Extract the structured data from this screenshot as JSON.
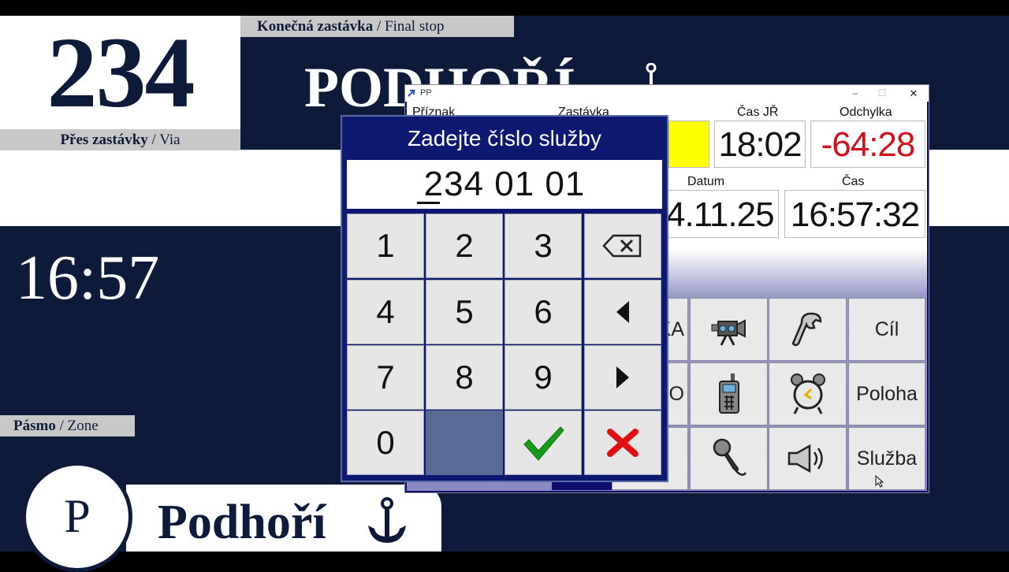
{
  "sign": {
    "route_number": "234",
    "via_label": "Přes zastávky",
    "via_label_en": "Via",
    "final_label": "Konečná zastávka",
    "final_label_en": "Final stop",
    "destination": "PODHOŘÍ",
    "clock": "16:57",
    "zone_label": "Pásmo",
    "zone_label_en": "Zone",
    "zone_letter": "P",
    "current_stop": "Podhoří"
  },
  "pp_window": {
    "title": "PP",
    "controls": {
      "minimize": "–",
      "maximize": "☐",
      "close": "✕"
    },
    "headers": {
      "flag": "Příznak",
      "stop": "Zastávka",
      "schedule_time": "Čas JŘ",
      "deviation": "Odchylka",
      "date": "Datum",
      "time": "Čas"
    },
    "values": {
      "schedule_time": "18:02",
      "deviation": "-64:28",
      "date": "4.11.25",
      "time": "16:57:32"
    },
    "buttons": {
      "partial_a": "KA",
      "partial_b": "O",
      "target": "Cíl",
      "position": "Poloha",
      "service": "Služba"
    },
    "icons": [
      "camera-icon",
      "wrench-icon",
      "phone-icon",
      "alarm-clock-icon",
      "microphone-icon",
      "speaker-icon"
    ]
  },
  "keypad": {
    "title": "Zadejte číslo služby",
    "input_value": "234 01 01",
    "keys": [
      "1",
      "2",
      "3",
      "4",
      "5",
      "6",
      "7",
      "8",
      "9",
      "0"
    ],
    "colors": {
      "ok": "#1a9a1a",
      "cancel": "#e01010"
    }
  }
}
